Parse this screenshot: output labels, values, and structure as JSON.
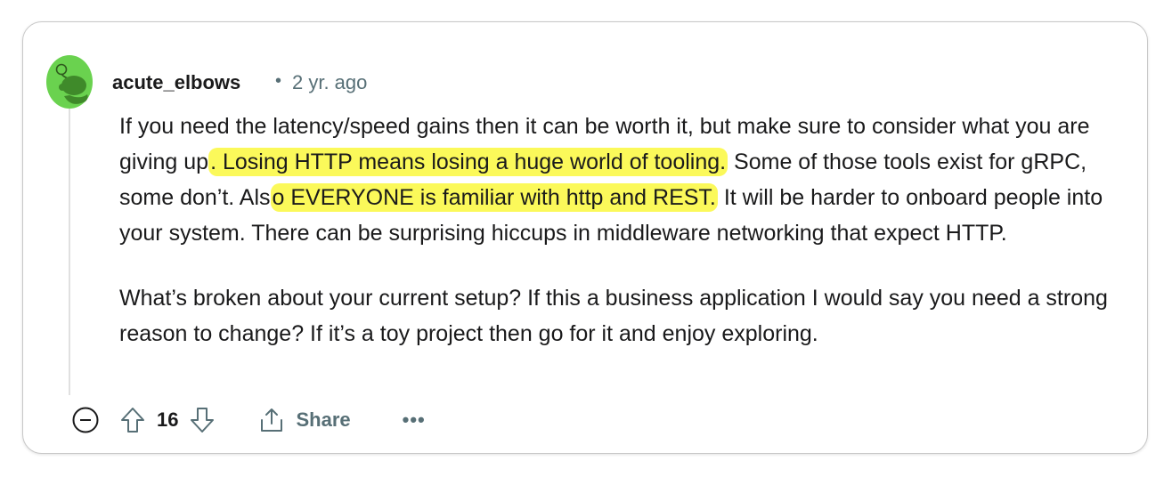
{
  "comment": {
    "author": "acute_elbows",
    "separator": "•",
    "time": "2 yr. ago",
    "paragraph1": {
      "t1": "If you need the latency/speed gains then it can be worth it, but make sure to consider what you are giving up",
      "h1": ". Losing HTTP means losing a huge world of tooling.",
      "t2": " Some of those tools exist for gRPC, some don’t. Als",
      "h2": "o EVERYONE is familiar with http and REST.",
      "t3": " It will be harder to onboard people into your system. There can be surprising hiccups in middleware networking that expect HTTP."
    },
    "paragraph2": "What’s broken about your current setup? If this a business application I would say you need a strong reason to change? If it’s a toy project then go for it and enjoy exploring.",
    "highlight_color": "#fbf95a",
    "avatar_color": "#6ad24f"
  },
  "actions": {
    "collapse_icon": "minus-circle-icon",
    "upvote_icon": "arrow-up-icon",
    "vote_count": "16",
    "downvote_icon": "arrow-down-icon",
    "share_icon": "share-icon",
    "share_label": "Share",
    "more_label": "•••"
  }
}
